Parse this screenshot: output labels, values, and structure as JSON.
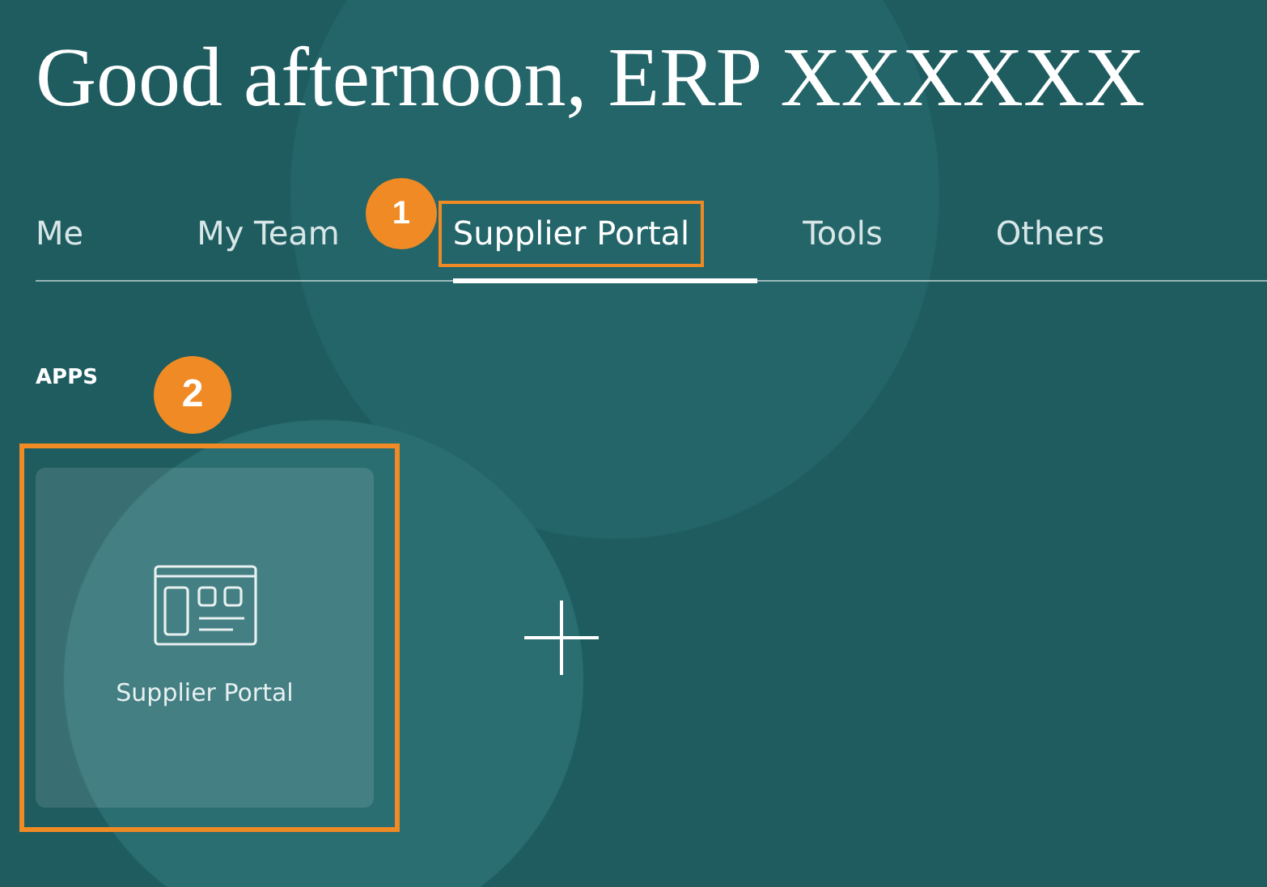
{
  "greeting": "Good afternoon, ERP XXXXXX",
  "tabs": [
    {
      "label": "Me",
      "selected": false
    },
    {
      "label": "My Team",
      "selected": false
    },
    {
      "label": "Supplier Portal",
      "selected": true,
      "callout": "1",
      "highlighted": true
    },
    {
      "label": "Tools",
      "selected": false
    },
    {
      "label": "Others",
      "selected": false
    }
  ],
  "apps_heading": "APPS",
  "apps": [
    {
      "label": "Supplier Portal",
      "highlighted": true,
      "callout": "2"
    }
  ]
}
